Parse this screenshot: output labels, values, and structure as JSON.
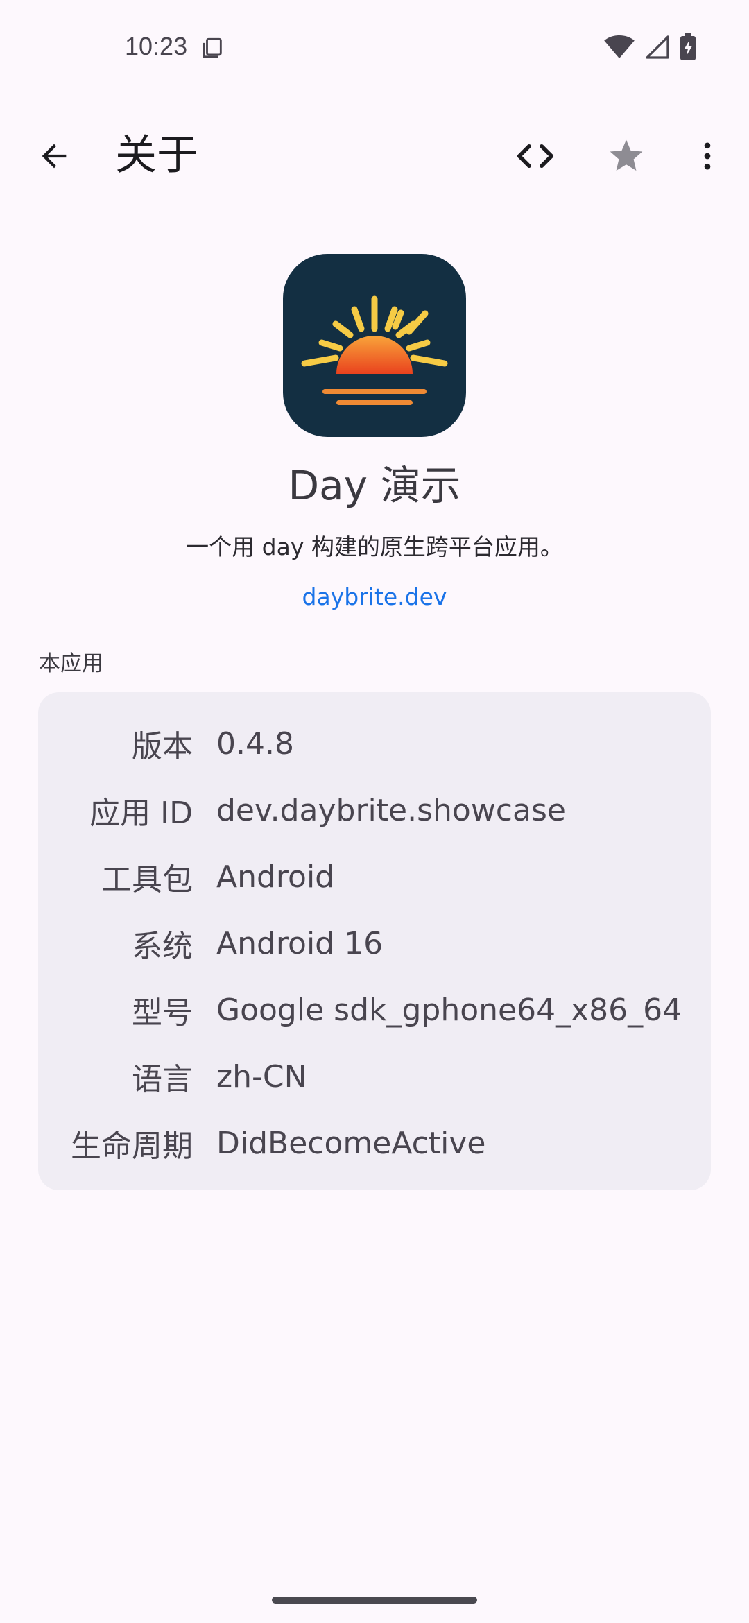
{
  "status_bar": {
    "time": "10:23"
  },
  "app_bar": {
    "title": "关于",
    "back_icon": "arrow-back-icon",
    "code_icon": "code-icon",
    "star_icon": "star-icon",
    "more_icon": "more-vert-icon"
  },
  "app": {
    "name": "Day 演示",
    "description": "一个用 day 构建的原生跨平台应用。",
    "link": "daybrite.dev",
    "icon": "sunrise-app-icon",
    "icon_bg_color": "#132f42"
  },
  "section": {
    "title": "本应用"
  },
  "info_rows": [
    {
      "label": "版本",
      "value": "0.4.8"
    },
    {
      "label": "应用 ID",
      "value": "dev.daybrite.showcase"
    },
    {
      "label": "工具包",
      "value": "Android"
    },
    {
      "label": "系统",
      "value": "Android 16"
    },
    {
      "label": "型号",
      "value": "Google sdk_gphone64_x86_64"
    },
    {
      "label": "语言",
      "value": "zh-CN"
    },
    {
      "label": "生命周期",
      "value": "DidBecomeActive"
    }
  ],
  "colors": {
    "background": "#fdf8fd",
    "card": "#f0edf4",
    "link": "#1a73e8"
  }
}
